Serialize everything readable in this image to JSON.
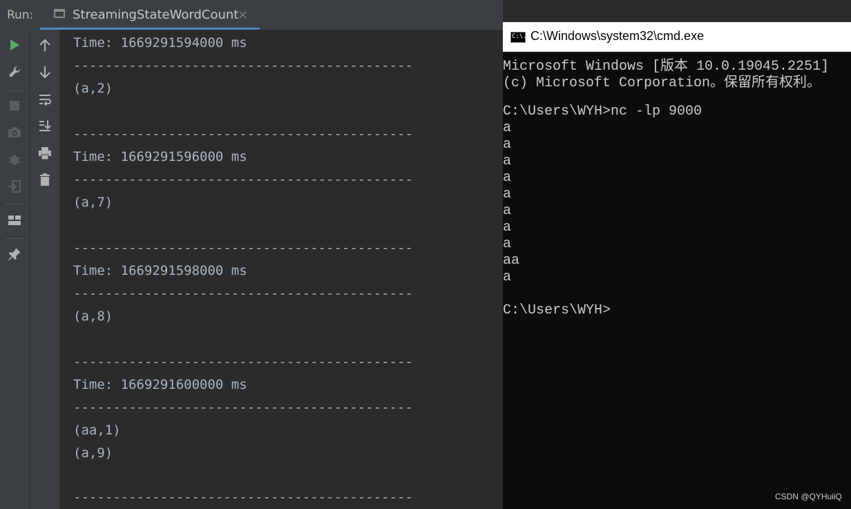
{
  "run_panel": {
    "label": "Run:",
    "tab_title": "StreamingStateWordCount",
    "tab_close": "×"
  },
  "toolbar": {
    "left_icons": [
      "run-icon",
      "wrench-icon",
      "stop-icon",
      "camera-icon",
      "debug-bug-icon",
      "exit-icon",
      "layout-icon",
      "pin-icon"
    ],
    "right_icons": [
      "arrow-up-icon",
      "arrow-down-icon",
      "soft-wrap-icon",
      "scroll-to-end-icon",
      "print-icon",
      "trash-icon"
    ],
    "run_color": "#59a869"
  },
  "console": {
    "lines": [
      "Time: 1669291594000 ms",
      "-------------------------------------------",
      "(a,2)",
      "",
      "-------------------------------------------",
      "Time: 1669291596000 ms",
      "-------------------------------------------",
      "(a,7)",
      "",
      "-------------------------------------------",
      "Time: 1669291598000 ms",
      "-------------------------------------------",
      "(a,8)",
      "",
      "-------------------------------------------",
      "Time: 1669291600000 ms",
      "-------------------------------------------",
      "(aa,1)",
      "(a,9)",
      "",
      "-------------------------------------------"
    ]
  },
  "cmd": {
    "title": "C:\\Windows\\system32\\cmd.exe",
    "icon_text": "C:\\.",
    "lines": [
      "Microsoft Windows [版本 10.0.19045.2251]",
      "(c) Microsoft Corporation。保留所有权利。",
      "",
      "C:\\Users\\WYH>nc -lp 9000",
      "a",
      "a",
      "a",
      "a",
      "a",
      "a",
      "a",
      "a",
      "aa",
      "a",
      "",
      "C:\\Users\\WYH>"
    ]
  },
  "watermark": "CSDN @QYHuiiQ"
}
